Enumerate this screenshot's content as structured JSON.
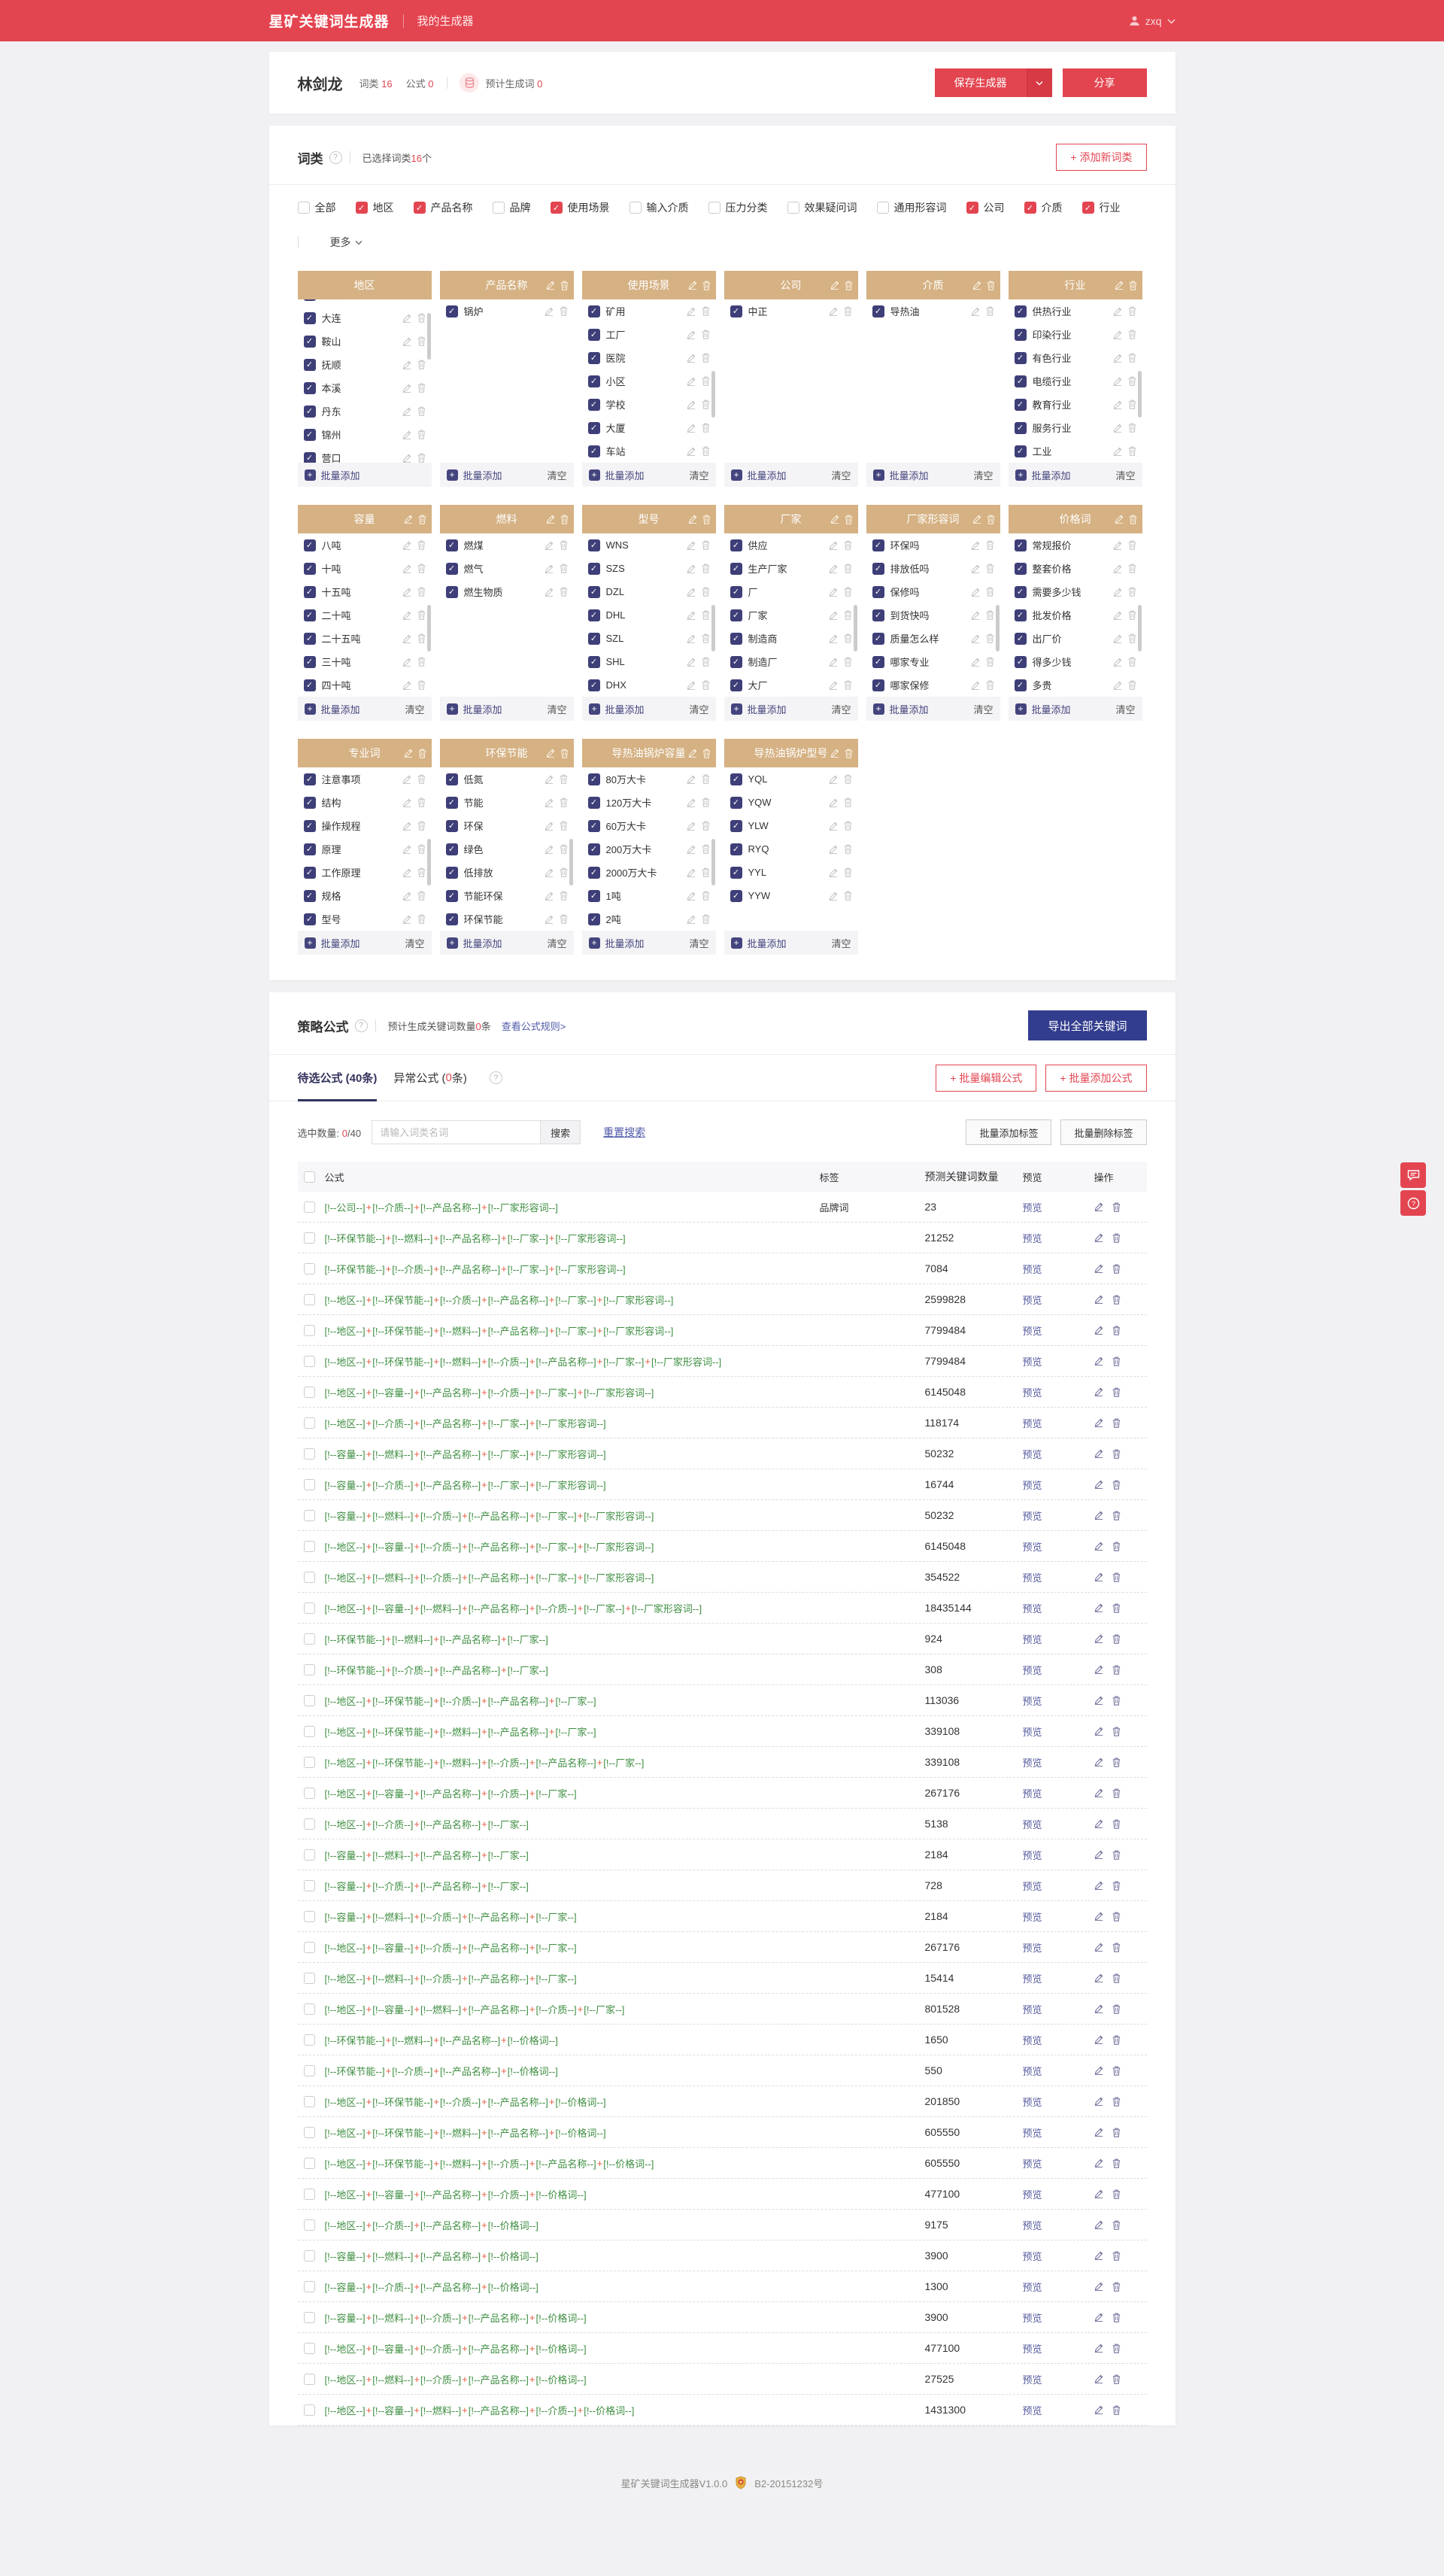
{
  "colors": {
    "brand": "#e34550",
    "card_header": "#d5b183",
    "checkbox_dark": "#3e3e78",
    "formula_green": "#3e8e41",
    "formula_plus": "#e4593c",
    "link": "#4f5aa8",
    "export_button": "#333d8e"
  },
  "header": {
    "app_title": "星矿关键词生成器",
    "nav": "我的生成器",
    "username": "zxq"
  },
  "userbar": {
    "name": "林剑龙",
    "cat_label": "词类",
    "cat_value": "16",
    "formula_label": "公式",
    "formula_value": "0",
    "estimate_label": "预计生成词",
    "estimate_value": "0",
    "save_button": "保存生成器",
    "share_button": "分享"
  },
  "wordcats": {
    "title": "词类",
    "selected_prefix": "已选择词类",
    "selected_count": "16",
    "selected_suffix": "个",
    "add_button": "+ 添加新词类",
    "more_label": "更多",
    "batch_add_label": "批量添加",
    "clear_label": "清空",
    "filters": [
      {
        "label": "全部",
        "checked": false
      },
      {
        "label": "地区",
        "checked": true
      },
      {
        "label": "产品名称",
        "checked": true
      },
      {
        "label": "品牌",
        "checked": false
      },
      {
        "label": "使用场景",
        "checked": true
      },
      {
        "label": "输入介质",
        "checked": false
      },
      {
        "label": "压力分类",
        "checked": false
      },
      {
        "label": "效果疑问词",
        "checked": false
      },
      {
        "label": "通用形容词",
        "checked": false
      },
      {
        "label": "公司",
        "checked": true
      },
      {
        "label": "介质",
        "checked": true
      },
      {
        "label": "行业",
        "checked": true
      }
    ],
    "cards": [
      {
        "title": "地区",
        "icons": false,
        "clear": false,
        "clipTop": true,
        "scrollbar": true,
        "items": [
          "沈阳",
          "大连",
          "鞍山",
          "抚顺",
          "本溪",
          "丹东",
          "锦州",
          "营口"
        ]
      },
      {
        "title": "产品名称",
        "items": [
          "锅炉"
        ]
      },
      {
        "title": "使用场景",
        "scrollbar": true,
        "items": [
          "矿用",
          "工厂",
          "医院",
          "小区",
          "学校",
          "大厦",
          "车站"
        ]
      },
      {
        "title": "公司",
        "items": [
          "中正"
        ]
      },
      {
        "title": "介质",
        "items": [
          "导热油"
        ]
      },
      {
        "title": "行业",
        "scrollbar": true,
        "items": [
          "供热行业",
          "印染行业",
          "有色行业",
          "电缆行业",
          "教育行业",
          "服务行业",
          "工业"
        ]
      },
      {
        "title": "容量",
        "scrollbar": true,
        "items": [
          "八吨",
          "十吨",
          "十五吨",
          "二十吨",
          "二十五吨",
          "三十吨",
          "四十吨"
        ]
      },
      {
        "title": "燃料",
        "items": [
          "燃煤",
          "燃气",
          "燃生物质"
        ]
      },
      {
        "title": "型号",
        "scrollbar": true,
        "items": [
          "WNS",
          "SZS",
          "DZL",
          "DHL",
          "SZL",
          "SHL",
          "DHX"
        ]
      },
      {
        "title": "厂家",
        "scrollbar": true,
        "items": [
          "供应",
          "生产厂家",
          "厂",
          "厂家",
          "制造商",
          "制造厂",
          "大厂"
        ]
      },
      {
        "title": "厂家形容词",
        "scrollbar": true,
        "items": [
          "环保吗",
          "排放低吗",
          "保修吗",
          "到货快吗",
          "质量怎么样",
          "哪家专业",
          "哪家保修"
        ]
      },
      {
        "title": "价格词",
        "scrollbar": true,
        "items": [
          "常规报价",
          "整套价格",
          "需要多少钱",
          "批发价格",
          "出厂价",
          "得多少钱",
          "多贵"
        ]
      },
      {
        "title": "专业词",
        "scrollbar": true,
        "items": [
          "注意事项",
          "结构",
          "操作规程",
          "原理",
          "工作原理",
          "规格",
          "型号"
        ]
      },
      {
        "title": "环保节能",
        "scrollbar": true,
        "items": [
          "低氮",
          "节能",
          "环保",
          "绿色",
          "低排放",
          "节能环保",
          "环保节能"
        ]
      },
      {
        "title": "导热油锅炉容量",
        "scrollbar": true,
        "items": [
          "80万大卡",
          "120万大卡",
          "60万大卡",
          "200万大卡",
          "2000万大卡",
          "1吨",
          "2吨"
        ]
      },
      {
        "title": "导热油锅炉型号",
        "items": [
          "YQL",
          "YQW",
          "YLW",
          "RYQ",
          "YYL",
          "YYW"
        ]
      }
    ]
  },
  "formula": {
    "title": "策略公式",
    "count_prefix": "预计生成关键词数量",
    "count": "0",
    "count_suffix": "条",
    "rules_link": "查看公式规则>",
    "export_button": "导出全部关键词",
    "tab1": "待选公式 (40条)",
    "tab2_prefix": "异常公式 (",
    "tab2_count": "0",
    "tab2_suffix": "条)",
    "batch_edit": "+ 批量编辑公式",
    "batch_add": "+ 批量添加公式",
    "selected_label": "选中数量:",
    "selected_count": "0",
    "selected_total": "/40",
    "search_placeholder": "请输入词类名词",
    "search_button": "搜索",
    "reset_search": "重置搜索",
    "tag_add": "批量添加标签",
    "tag_delete": "批量删除标签",
    "table": {
      "headers": {
        "formula": "公式",
        "tag": "标签",
        "count": "预测关键词数量",
        "preview": "预览",
        "ops": "操作"
      },
      "preview_label": "预览",
      "rows": [
        {
          "f": [
            "公司",
            "介质",
            "产品名称",
            "厂家形容词"
          ],
          "t": "品牌词",
          "n": "23"
        },
        {
          "f": [
            "环保节能",
            "燃料",
            "产品名称",
            "厂家",
            "厂家形容词"
          ],
          "t": "",
          "n": "21252"
        },
        {
          "f": [
            "环保节能",
            "介质",
            "产品名称",
            "厂家",
            "厂家形容词"
          ],
          "t": "",
          "n": "7084"
        },
        {
          "f": [
            "地区",
            "环保节能",
            "介质",
            "产品名称",
            "厂家",
            "厂家形容词"
          ],
          "t": "",
          "n": "2599828"
        },
        {
          "f": [
            "地区",
            "环保节能",
            "燃料",
            "产品名称",
            "厂家",
            "厂家形容词"
          ],
          "t": "",
          "n": "7799484"
        },
        {
          "f": [
            "地区",
            "环保节能",
            "燃料",
            "介质",
            "产品名称",
            "厂家",
            "厂家形容词"
          ],
          "t": "",
          "n": "7799484"
        },
        {
          "f": [
            "地区",
            "容量",
            "产品名称",
            "介质",
            "厂家",
            "厂家形容词"
          ],
          "t": "",
          "n": "6145048"
        },
        {
          "f": [
            "地区",
            "介质",
            "产品名称",
            "厂家",
            "厂家形容词"
          ],
          "t": "",
          "n": "118174"
        },
        {
          "f": [
            "容量",
            "燃料",
            "产品名称",
            "厂家",
            "厂家形容词"
          ],
          "t": "",
          "n": "50232"
        },
        {
          "f": [
            "容量",
            "介质",
            "产品名称",
            "厂家",
            "厂家形容词"
          ],
          "t": "",
          "n": "16744"
        },
        {
          "f": [
            "容量",
            "燃料",
            "介质",
            "产品名称",
            "厂家",
            "厂家形容词"
          ],
          "t": "",
          "n": "50232"
        },
        {
          "f": [
            "地区",
            "容量",
            "介质",
            "产品名称",
            "厂家",
            "厂家形容词"
          ],
          "t": "",
          "n": "6145048"
        },
        {
          "f": [
            "地区",
            "燃料",
            "介质",
            "产品名称",
            "厂家",
            "厂家形容词"
          ],
          "t": "",
          "n": "354522"
        },
        {
          "f": [
            "地区",
            "容量",
            "燃料",
            "产品名称",
            "介质",
            "厂家",
            "厂家形容词"
          ],
          "t": "",
          "n": "18435144"
        },
        {
          "f": [
            "环保节能",
            "燃料",
            "产品名称",
            "厂家"
          ],
          "t": "",
          "n": "924"
        },
        {
          "f": [
            "环保节能",
            "介质",
            "产品名称",
            "厂家"
          ],
          "t": "",
          "n": "308"
        },
        {
          "f": [
            "地区",
            "环保节能",
            "介质",
            "产品名称",
            "厂家"
          ],
          "t": "",
          "n": "113036"
        },
        {
          "f": [
            "地区",
            "环保节能",
            "燃料",
            "产品名称",
            "厂家"
          ],
          "t": "",
          "n": "339108"
        },
        {
          "f": [
            "地区",
            "环保节能",
            "燃料",
            "介质",
            "产品名称",
            "厂家"
          ],
          "t": "",
          "n": "339108"
        },
        {
          "f": [
            "地区",
            "容量",
            "产品名称",
            "介质",
            "厂家"
          ],
          "t": "",
          "n": "267176"
        },
        {
          "f": [
            "地区",
            "介质",
            "产品名称",
            "厂家"
          ],
          "t": "",
          "n": "5138"
        },
        {
          "f": [
            "容量",
            "燃料",
            "产品名称",
            "厂家"
          ],
          "t": "",
          "n": "2184"
        },
        {
          "f": [
            "容量",
            "介质",
            "产品名称",
            "厂家"
          ],
          "t": "",
          "n": "728"
        },
        {
          "f": [
            "容量",
            "燃料",
            "介质",
            "产品名称",
            "厂家"
          ],
          "t": "",
          "n": "2184"
        },
        {
          "f": [
            "地区",
            "容量",
            "介质",
            "产品名称",
            "厂家"
          ],
          "t": "",
          "n": "267176"
        },
        {
          "f": [
            "地区",
            "燃料",
            "介质",
            "产品名称",
            "厂家"
          ],
          "t": "",
          "n": "15414"
        },
        {
          "f": [
            "地区",
            "容量",
            "燃料",
            "产品名称",
            "介质",
            "厂家"
          ],
          "t": "",
          "n": "801528"
        },
        {
          "f": [
            "环保节能",
            "燃料",
            "产品名称",
            "价格词"
          ],
          "t": "",
          "n": "1650"
        },
        {
          "f": [
            "环保节能",
            "介质",
            "产品名称",
            "价格词"
          ],
          "t": "",
          "n": "550"
        },
        {
          "f": [
            "地区",
            "环保节能",
            "介质",
            "产品名称",
            "价格词"
          ],
          "t": "",
          "n": "201850"
        },
        {
          "f": [
            "地区",
            "环保节能",
            "燃料",
            "产品名称",
            "价格词"
          ],
          "t": "",
          "n": "605550"
        },
        {
          "f": [
            "地区",
            "环保节能",
            "燃料",
            "介质",
            "产品名称",
            "价格词"
          ],
          "t": "",
          "n": "605550"
        },
        {
          "f": [
            "地区",
            "容量",
            "产品名称",
            "介质",
            "价格词"
          ],
          "t": "",
          "n": "477100"
        },
        {
          "f": [
            "地区",
            "介质",
            "产品名称",
            "价格词"
          ],
          "t": "",
          "n": "9175"
        },
        {
          "f": [
            "容量",
            "燃料",
            "产品名称",
            "价格词"
          ],
          "t": "",
          "n": "3900"
        },
        {
          "f": [
            "容量",
            "介质",
            "产品名称",
            "价格词"
          ],
          "t": "",
          "n": "1300"
        },
        {
          "f": [
            "容量",
            "燃料",
            "介质",
            "产品名称",
            "价格词"
          ],
          "t": "",
          "n": "3900"
        },
        {
          "f": [
            "地区",
            "容量",
            "介质",
            "产品名称",
            "价格词"
          ],
          "t": "",
          "n": "477100"
        },
        {
          "f": [
            "地区",
            "燃料",
            "介质",
            "产品名称",
            "价格词"
          ],
          "t": "",
          "n": "27525"
        },
        {
          "f": [
            "地区",
            "容量",
            "燃料",
            "产品名称",
            "介质",
            "价格词"
          ],
          "t": "",
          "n": "1431300"
        }
      ]
    }
  },
  "footer": {
    "version": "星矿关键词生成器V1.0.0",
    "icp": "B2-20151232号"
  }
}
